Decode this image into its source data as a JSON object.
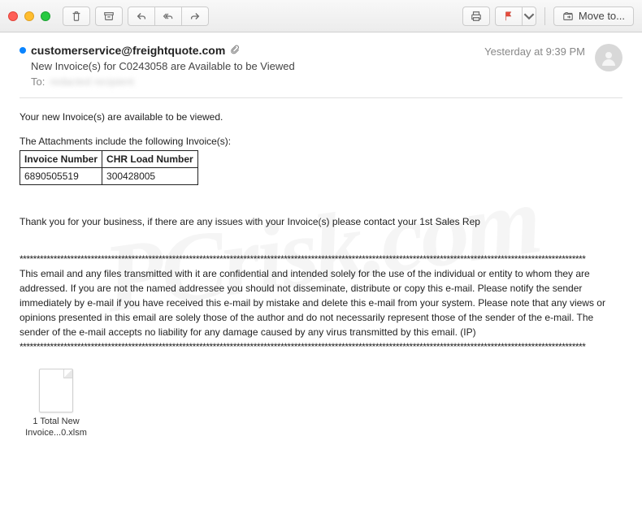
{
  "toolbar": {
    "moveto_label": "Move to..."
  },
  "email": {
    "sender": "customerservice@freightquote.com",
    "subject": "New Invoice(s) for C0243058 are Available to be Viewed",
    "to_label": "To:",
    "to_value": "redacted recipient",
    "timestamp": "Yesterday at 9:39 PM"
  },
  "body": {
    "intro": "Your new Invoice(s) are available to be viewed.",
    "attachments_caption": "The Attachments include the following Invoice(s):",
    "table": {
      "col1": "Invoice Number",
      "col2": "CHR Load Number",
      "row": {
        "invoice": "6890505519",
        "load": "300428005"
      }
    },
    "thankyou": "Thank you for your business, if there are any issues with your Invoice(s) please contact your 1st Sales Rep",
    "stars": "***********************************************************************************************************************************************************************",
    "disclaimer": "This email and any files transmitted with it are confidential and intended solely for the use of the individual or entity to whom they are addressed. If you are not the named addressee you should not disseminate, distribute or copy this e-mail. Please notify the sender immediately by e-mail if you have received this e-mail by mistake and delete this e-mail from your system. Please note that any views or opinions presented in this email are solely those of the author and do not necessarily represent those of the sender of the e-mail. The sender of the e-mail accepts no liability for any damage caused by any virus transmitted by this email. (IP)"
  },
  "attachment": {
    "filename": "1 Total New Invoice...0.xlsm"
  },
  "watermark": "PCrisk.com"
}
